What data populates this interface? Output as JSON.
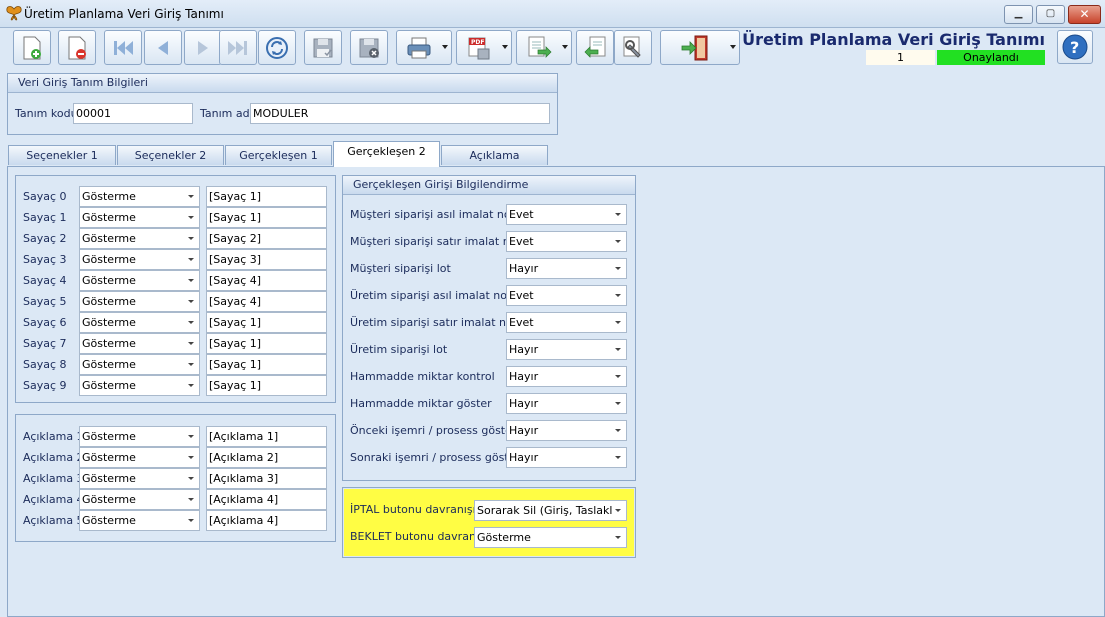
{
  "window": {
    "title": "Üretim Planlama Veri Giriş Tanımı"
  },
  "header": {
    "form_title": "Üretim Planlama Veri Giriş Tanımı",
    "record_no": "1",
    "status": "Onaylandı"
  },
  "colors": {
    "status_green": "#22e022",
    "highlight": "#fffd44",
    "title_blue": "#1a2a6e"
  },
  "toolbar": {
    "buttons": [
      {
        "name": "new-record",
        "icon": "page-add-icon"
      },
      {
        "name": "delete-record",
        "icon": "page-delete-icon"
      },
      {
        "name": "first-record",
        "icon": "first-icon"
      },
      {
        "name": "previous-record",
        "icon": "previous-icon"
      },
      {
        "name": "next-record",
        "icon": "next-icon"
      },
      {
        "name": "last-record",
        "icon": "last-icon"
      },
      {
        "name": "refresh",
        "icon": "refresh-icon"
      },
      {
        "name": "save",
        "icon": "save-icon"
      },
      {
        "name": "cancel",
        "icon": "save-cancel-icon"
      },
      {
        "name": "print",
        "icon": "printer-icon"
      },
      {
        "name": "pdf-export",
        "icon": "pdf-icon"
      },
      {
        "name": "export",
        "icon": "export-icon"
      },
      {
        "name": "import",
        "icon": "import-icon"
      },
      {
        "name": "settings",
        "icon": "wrench-icon"
      },
      {
        "name": "exit",
        "icon": "exit-door-icon"
      }
    ]
  },
  "info": {
    "group_title": "Veri Giriş Tanım Bilgileri",
    "code_label": "Tanım kodu",
    "code_value": "00001",
    "name_label": "Tanım adı",
    "name_value": "MODULER"
  },
  "tabs": [
    "Seçenekler 1",
    "Seçenekler 2",
    "Gerçekleşen 1",
    "Gerçekleşen 2",
    "Açıklama"
  ],
  "active_tab": "Gerçekleşen 2",
  "counters": [
    {
      "label": "Sayaç 0",
      "mode": "Gösterme",
      "text": "[Sayaç 1]"
    },
    {
      "label": "Sayaç 1",
      "mode": "Gösterme",
      "text": "[Sayaç 1]"
    },
    {
      "label": "Sayaç 2",
      "mode": "Gösterme",
      "text": "[Sayaç 2]"
    },
    {
      "label": "Sayaç 3",
      "mode": "Gösterme",
      "text": "[Sayaç 3]"
    },
    {
      "label": "Sayaç 4",
      "mode": "Gösterme",
      "text": "[Sayaç 4]"
    },
    {
      "label": "Sayaç 5",
      "mode": "Gösterme",
      "text": "[Sayaç 4]"
    },
    {
      "label": "Sayaç 6",
      "mode": "Gösterme",
      "text": "[Sayaç 1]"
    },
    {
      "label": "Sayaç 7",
      "mode": "Gösterme",
      "text": "[Sayaç 1]"
    },
    {
      "label": "Sayaç 8",
      "mode": "Gösterme",
      "text": "[Sayaç 1]"
    },
    {
      "label": "Sayaç 9",
      "mode": "Gösterme",
      "text": "[Sayaç 1]"
    }
  ],
  "descriptions": [
    {
      "label": "Açıklama 1",
      "mode": "Gösterme",
      "text": "[Açıklama 1]"
    },
    {
      "label": "Açıklama 2",
      "mode": "Gösterme",
      "text": "[Açıklama 2]"
    },
    {
      "label": "Açıklama 3",
      "mode": "Gösterme",
      "text": "[Açıklama 3]"
    },
    {
      "label": "Açıklama 4",
      "mode": "Gösterme",
      "text": "[Açıklama 4]"
    },
    {
      "label": "Açıklama 5",
      "mode": "Gösterme",
      "text": "[Açıklama 4]"
    }
  ],
  "realized": {
    "group_title": "Gerçekleşen Girişi Bilgilendirme",
    "rows": [
      {
        "label": "Müşteri siparişi asıl imalat notu",
        "value": "Evet"
      },
      {
        "label": "Müşteri siparişi satır imalat notu",
        "value": "Evet"
      },
      {
        "label": "Müşteri siparişi lot",
        "value": "Hayır"
      },
      {
        "label": "Üretim siparişi asıl imalat notu",
        "value": "Evet"
      },
      {
        "label": "Üretim siparişi satır imalat notu",
        "value": "Evet"
      },
      {
        "label": "Üretim siparişi lot",
        "value": "Hayır"
      },
      {
        "label": "Hammadde miktar kontrol",
        "value": "Hayır"
      },
      {
        "label": "Hammadde miktar göster",
        "value": "Hayır"
      },
      {
        "label": "Önceki işemri / prosess göster",
        "value": "Hayır"
      },
      {
        "label": "Sonraki işemri / prosess göster",
        "value": "Hayır"
      }
    ]
  },
  "buttons_behavior": {
    "cancel_label": "İPTAL butonu davranışı",
    "cancel_value": "Sorarak Sil (Giriş, Taslakları)",
    "hold_label": "BEKLET butonu davranışı",
    "hold_value": "Gösterme"
  }
}
